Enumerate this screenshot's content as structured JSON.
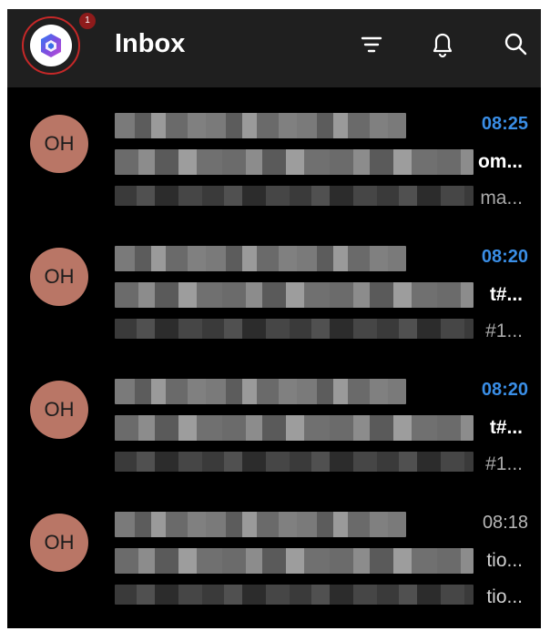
{
  "header": {
    "title": "Inbox",
    "badge_count": "1",
    "account_icon": "microsoft-365-icon",
    "icons": [
      "filter-icon",
      "bell-icon",
      "search-icon"
    ]
  },
  "colors": {
    "unread_time": "#3a8ee6",
    "avatar_bg": "#b97666",
    "badge_bg": "#8e1b1b"
  },
  "messages": [
    {
      "initials": "OH",
      "time": "08:25",
      "subject_tail": "om...",
      "preview_tail": "ma...",
      "unread": true
    },
    {
      "initials": "OH",
      "time": "08:20",
      "subject_tail": "t#...",
      "preview_tail": "#1...",
      "unread": true
    },
    {
      "initials": "OH",
      "time": "08:20",
      "subject_tail": "t#...",
      "preview_tail": "#1...",
      "unread": true
    },
    {
      "initials": "OH",
      "time": "08:18",
      "subject_tail": "tio...",
      "preview_tail": "tio...",
      "unread": false
    }
  ]
}
